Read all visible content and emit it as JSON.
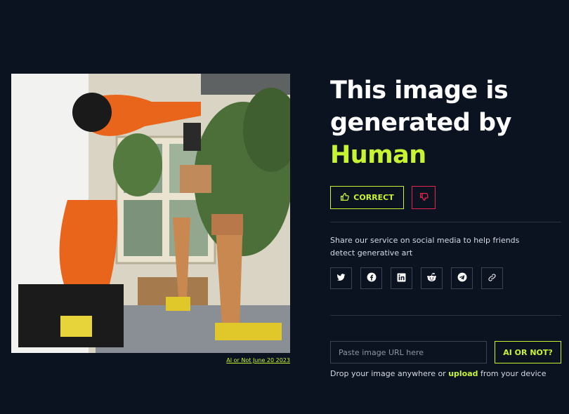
{
  "result": {
    "headline_line1": "This image is",
    "headline_line2": "generated by",
    "verdict": "Human"
  },
  "feedback": {
    "correct_label": "CORRECT",
    "correct_icon": "thumbs-up-icon",
    "wrong_icon": "thumbs-down-icon"
  },
  "image": {
    "caption": "AI or Not June 20 2023"
  },
  "share": {
    "text": "Share our service on social media to help friends detect generative art",
    "networks": [
      "twitter",
      "facebook",
      "linkedin",
      "reddit",
      "telegram",
      "copy-link"
    ]
  },
  "check": {
    "placeholder": "Paste image URL here",
    "button_label": "AI OR NOT?",
    "drop_prefix": "Drop your image anywhere or ",
    "drop_link": "upload",
    "drop_suffix": " from your device"
  },
  "colors": {
    "background": "#0b1220",
    "accent": "#c6f432",
    "danger": "#e0284f"
  }
}
